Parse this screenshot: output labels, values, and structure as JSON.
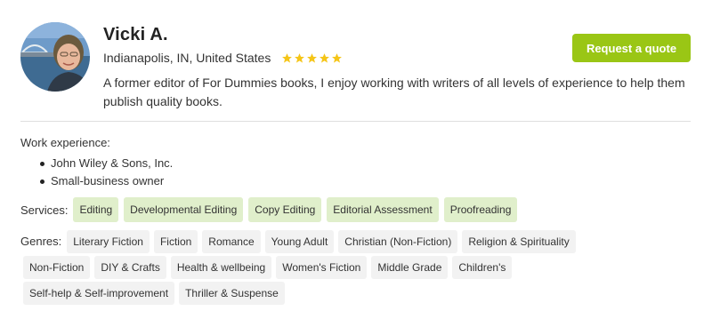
{
  "profile": {
    "name": "Vicki A.",
    "location": "Indianapolis, IN, United States",
    "rating_stars": 5,
    "bio": "A former editor of For Dummies books, I enjoy working with writers of all levels of experience to help them publish quality books."
  },
  "actions": {
    "request_quote": "Request a quote"
  },
  "work": {
    "label": "Work experience:",
    "items": [
      "John Wiley & Sons, Inc.",
      "Small-business owner"
    ]
  },
  "services": {
    "label": "Services:",
    "tags": [
      "Editing",
      "Developmental Editing",
      "Copy Editing",
      "Editorial Assessment",
      "Proofreading"
    ]
  },
  "genres": {
    "label": "Genres:",
    "tags": [
      "Literary Fiction",
      "Fiction",
      "Romance",
      "Young Adult",
      "Christian (Non-Fiction)",
      "Religion & Spirituality",
      "Non-Fiction",
      "DIY & Crafts",
      "Health & wellbeing",
      "Women's Fiction",
      "Middle Grade",
      "Children's",
      "Self-help & Self-improvement",
      "Thriller & Suspense"
    ]
  },
  "colors": {
    "accent": "#9ac615",
    "service_tag_bg": "#e0efcb",
    "genre_tag_bg": "#f2f2f2",
    "star": "#f5c518"
  }
}
